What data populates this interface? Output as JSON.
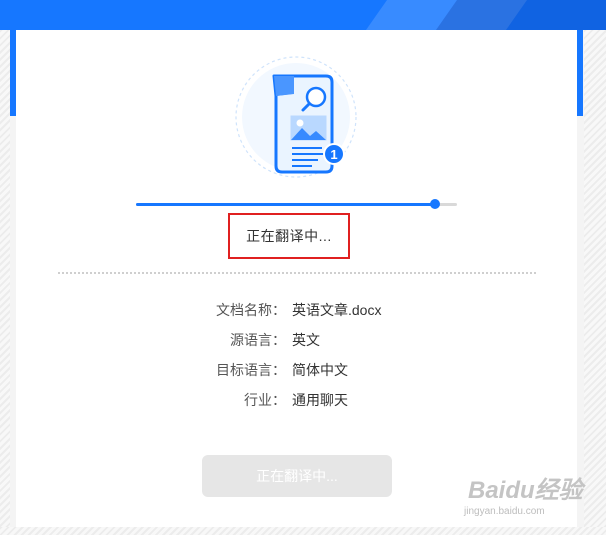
{
  "colors": {
    "primary": "#1677ff",
    "highlight_border": "#e02020",
    "button_disabled_bg": "#e6e6e6",
    "text": "#333333"
  },
  "illustration": {
    "icon": "document-with-image-and-magnifier-icon",
    "badge": "1"
  },
  "progress": {
    "percent": 93
  },
  "status": {
    "text": "正在翻译中..."
  },
  "details": [
    {
      "label": "文档名称：",
      "value": "英语文章.docx"
    },
    {
      "label": "源语言：",
      "value": "英文"
    },
    {
      "label": "目标语言：",
      "value": "简体中文"
    },
    {
      "label": "行业：",
      "value": "通用聊天"
    }
  ],
  "action_button": {
    "label": "正在翻译中...",
    "disabled": true
  },
  "watermark": {
    "logo": "Baidu经验",
    "url": "jingyan.baidu.com"
  }
}
